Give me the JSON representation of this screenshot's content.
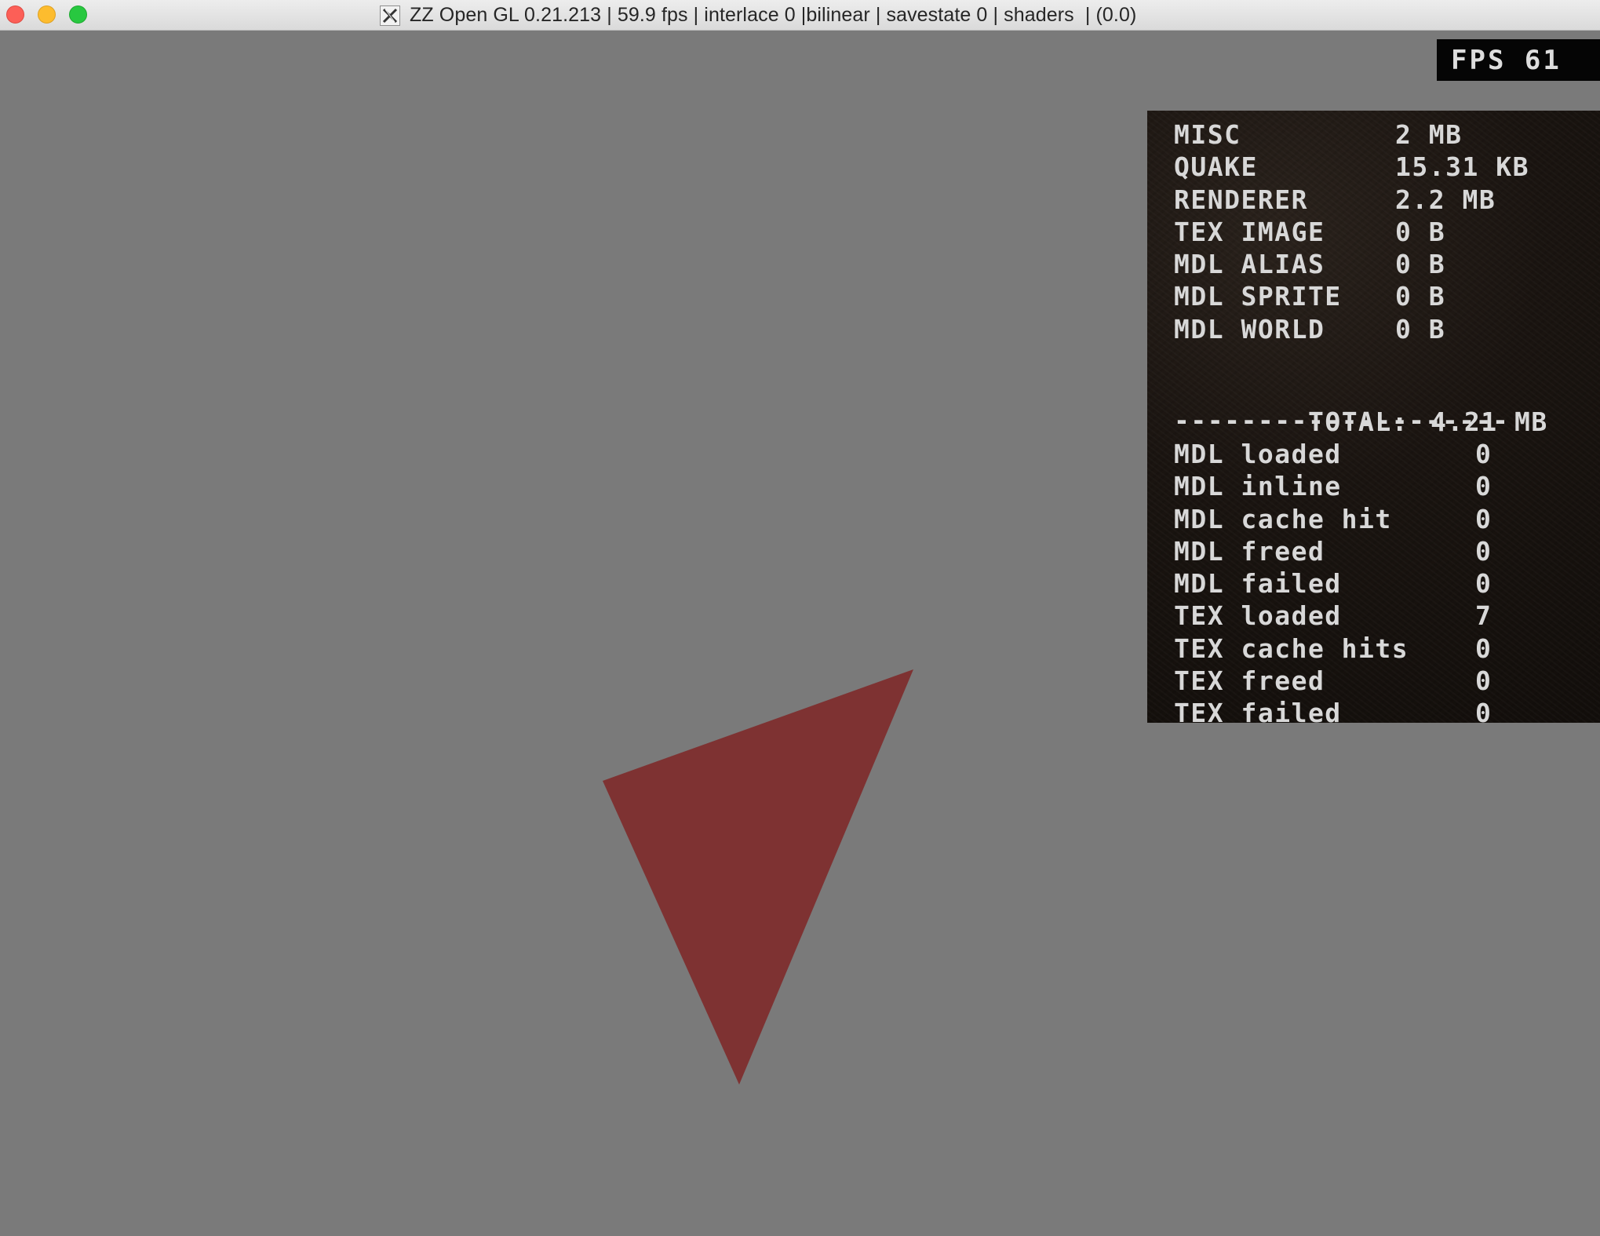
{
  "window": {
    "title": "ZZ Open GL 0.21.213 | 59.9 fps | interlace 0 |bilinear | savestate 0 | shaders  | (0.0)"
  },
  "colors": {
    "background": "#7a7a7a",
    "triangle": "#7e3232",
    "panel": "#1a1410",
    "panel_text": "#d8d8d8"
  },
  "fps_counter": {
    "text": "FPS 61"
  },
  "stats": {
    "memory": [
      {
        "label": "MISC",
        "value": "2 MB"
      },
      {
        "label": "QUAKE",
        "value": "15.31 KB"
      },
      {
        "label": "RENDERER",
        "value": "2.2 MB"
      },
      {
        "label": "TEX IMAGE",
        "value": "0 B"
      },
      {
        "label": "MDL ALIAS",
        "value": "0 B"
      },
      {
        "label": "MDL SPRITE",
        "value": "0 B"
      },
      {
        "label": "MDL WORLD",
        "value": "0 B"
      }
    ],
    "total": {
      "label": "TOTAL:",
      "value": "4.21 MB"
    },
    "divider": "--------------------",
    "counts": [
      {
        "label": "MDL loaded",
        "value": "0"
      },
      {
        "label": "MDL inline",
        "value": "0"
      },
      {
        "label": "MDL cache hit",
        "value": "0"
      },
      {
        "label": "MDL freed",
        "value": "0"
      },
      {
        "label": "MDL failed",
        "value": "0"
      },
      {
        "label": "TEX loaded",
        "value": "7"
      },
      {
        "label": "TEX cache hits",
        "value": "0"
      },
      {
        "label": "TEX freed",
        "value": "0"
      },
      {
        "label": "TEX failed",
        "value": "0"
      }
    ]
  }
}
